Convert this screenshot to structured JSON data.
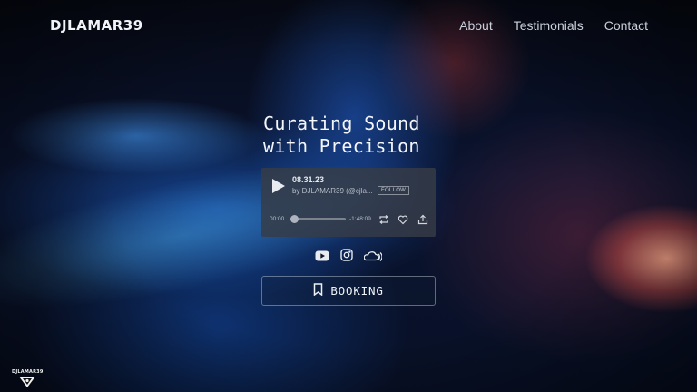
{
  "header": {
    "logo": "DJLAMAR39",
    "nav": [
      {
        "label": "About"
      },
      {
        "label": "Testimonials"
      },
      {
        "label": "Contact"
      }
    ]
  },
  "hero": {
    "headline_line1": "Curating Sound",
    "headline_line2": "with Precision"
  },
  "player": {
    "track_title": "08.31.23",
    "by_line": "by DJLAMAR39 (@cjla...",
    "follow_label": "FOLLOW",
    "time_elapsed": "00:00",
    "time_remaining": "-1:48:09",
    "progress": 0,
    "icons": [
      "play-icon",
      "repeat-icon",
      "heart-icon",
      "share-icon"
    ]
  },
  "social": {
    "icons": [
      "youtube-icon",
      "instagram-icon",
      "soundcloud-icon"
    ]
  },
  "booking": {
    "label": "BOOKING",
    "icon": "bookmark-icon"
  },
  "badge": {
    "text": "DJLAMAR39"
  },
  "colors": {
    "text": "#f4f6fa",
    "nav_text": "#c9d0da",
    "player_bg": "#373c46",
    "accent_blue": "#1e6ee6",
    "accent_red": "#e65a50"
  }
}
